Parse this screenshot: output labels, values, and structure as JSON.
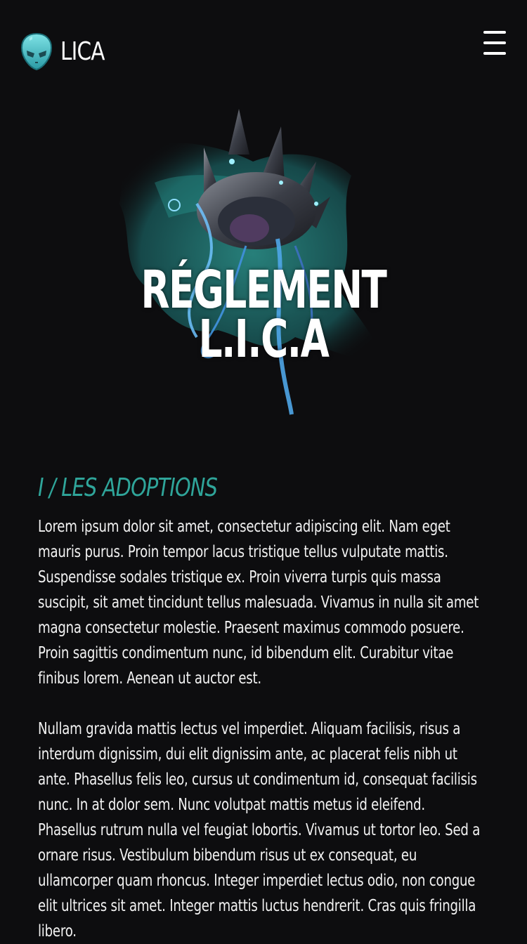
{
  "header": {
    "brand_name": "LICA",
    "logo_icon": "alien-head-icon",
    "menu_icon": "hamburger-menu-icon"
  },
  "hero": {
    "title_line1": "RÉGLEMENT",
    "title_line2": "L.I.C.A",
    "accent_color": "#1f6f6a"
  },
  "section": {
    "title": "I / LES ADOPTIONS",
    "title_color": "#2fa59a",
    "paragraphs": [
      "Lorem ipsum dolor sit amet, consectetur adipiscing elit. Nam eget mauris purus. Proin tempor lacus tristique tellus vulputate mattis. Suspendisse sodales tristique ex. Proin viverra turpis quis massa suscipit, sit amet tincidunt tellus malesuada. Vivamus in nulla sit amet magna consectetur molestie. Praesent maximus commodo posuere. Proin sagittis condimentum nunc, id bibendum elit. Curabitur vitae finibus lorem. Aenean ut auctor est.",
      "Nullam gravida mattis lectus vel imperdiet. Aliquam facilisis, risus a interdum dignissim, dui elit dignissim ante, ac placerat felis nibh ut ante. Phasellus felis leo, cursus ut condimentum id, consequat facilisis nunc. In at dolor sem. Nunc volutpat mattis metus id eleifend. Phasellus rutrum nulla vel feugiat lobortis. Vivamus ut tortor leo. Sed a ornare risus. Vestibulum bibendum risus ut ex consequat, eu ullamcorper quam rhoncus. Integer imperdiet lectus odio, non congue elit ultrices sit amet. Integer mattis luctus hendrerit. Cras quis fringilla libero."
    ]
  },
  "colors": {
    "background": "#0d0d0f",
    "text": "#ffffff",
    "accent": "#2fa59a"
  }
}
